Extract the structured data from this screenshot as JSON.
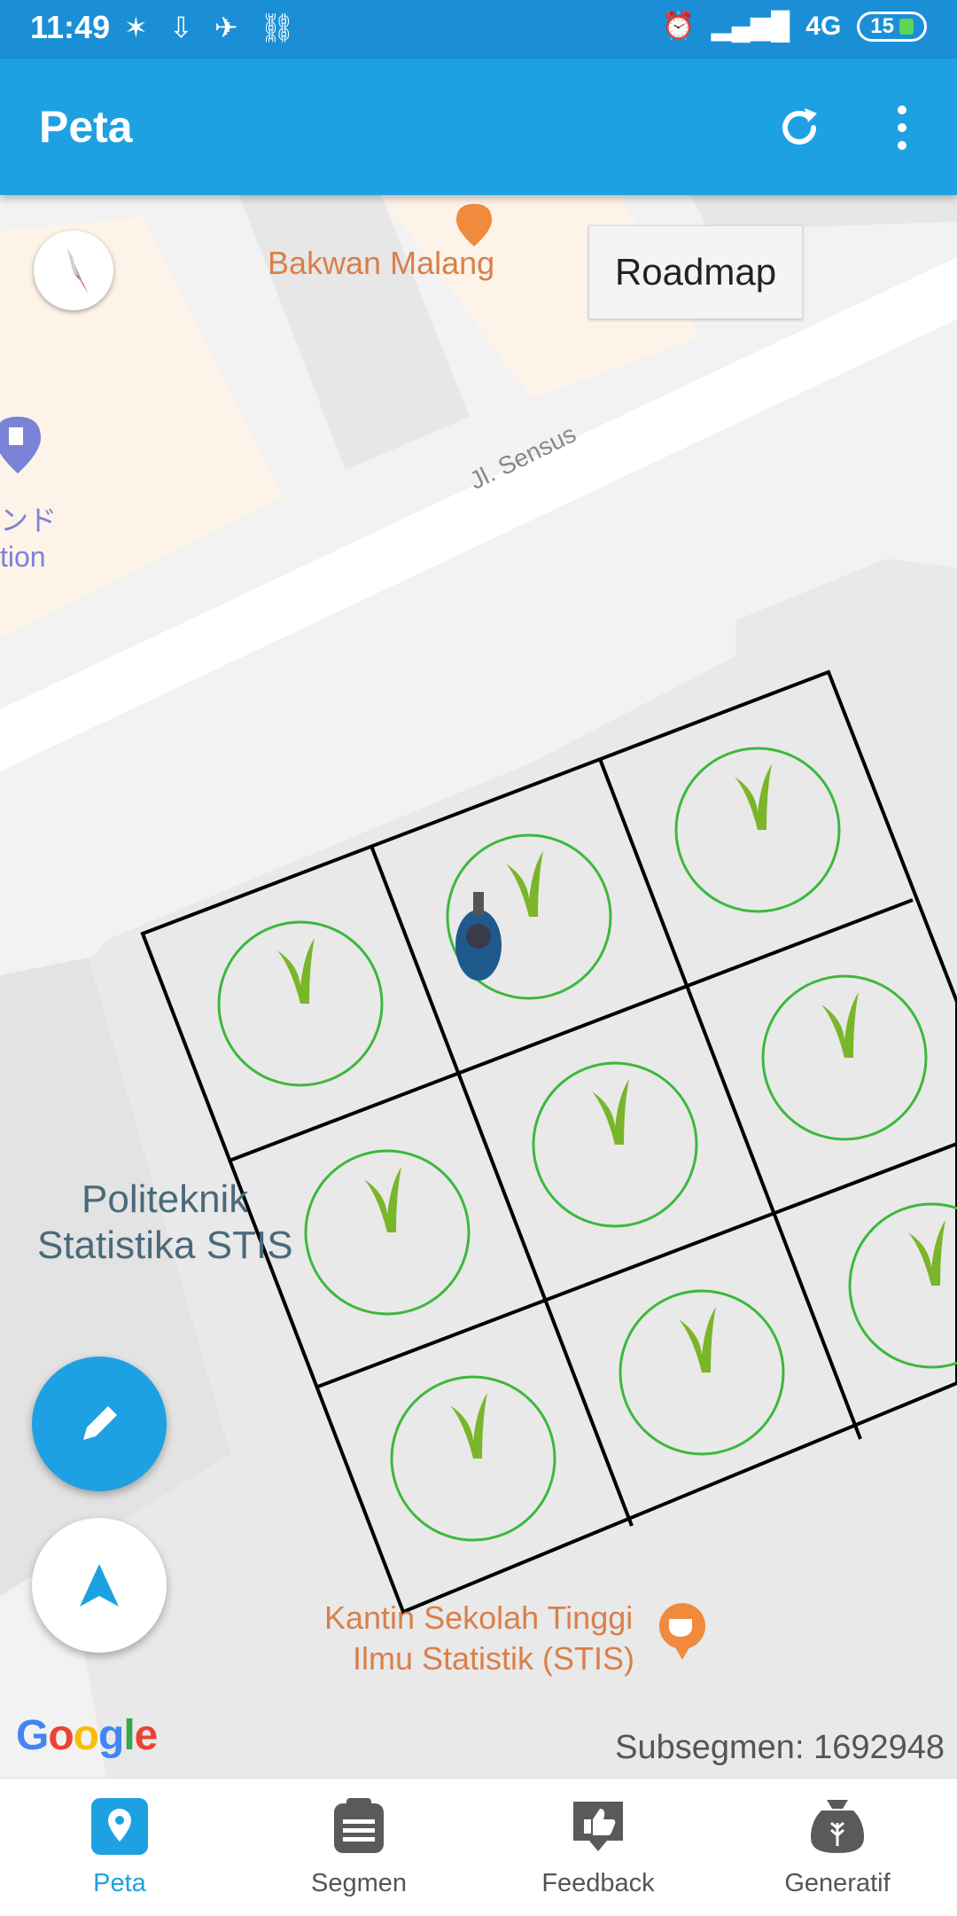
{
  "status_bar": {
    "time": "11:49",
    "network": "4G",
    "battery": "15"
  },
  "app_bar": {
    "title": "Peta"
  },
  "map": {
    "roadmap_button": "Roadmap",
    "labels": {
      "poi_top": "Bakwan Malang",
      "street": "Jl. Sensus",
      "cut_label_1": "ンド",
      "cut_label_2": "tion",
      "campus_line1": "Politeknik",
      "campus_line2": "Statistika STIS",
      "canteen_line1": "Kantin Sekolah Tinggi",
      "canteen_line2": "Ilmu Statistik (STIS)"
    },
    "google_logo": "Google",
    "subsegment_text": "Subsegmen: 1692948"
  },
  "bottom_nav": {
    "items": [
      {
        "label": "Peta",
        "icon": "map-pin-icon",
        "active": true
      },
      {
        "label": "Segmen",
        "icon": "clipboard-icon",
        "active": false
      },
      {
        "label": "Feedback",
        "icon": "thumbs-up-icon",
        "active": false
      },
      {
        "label": "Generatif",
        "icon": "grain-sack-icon",
        "active": false
      }
    ]
  },
  "colors": {
    "primary": "#1da1e2",
    "status_bar": "#1b8fd6",
    "grid_line": "#000000",
    "circle": "#3cb83c",
    "poi_label": "#d9804a"
  }
}
